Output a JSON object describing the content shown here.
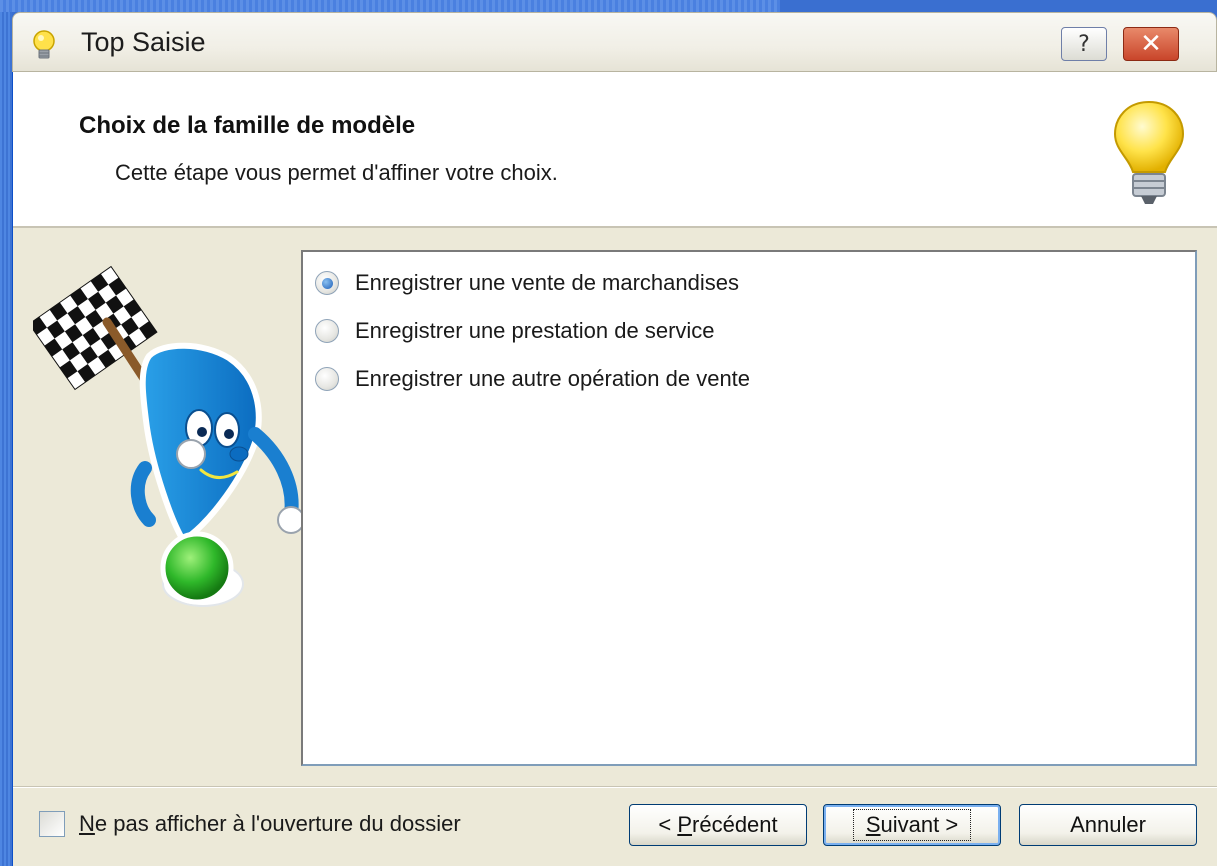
{
  "window": {
    "title": "Top Saisie",
    "help_glyph": "?",
    "close_glyph": "✕",
    "icons": [
      "lightbulb-icon",
      "help-icon",
      "close-icon"
    ]
  },
  "header": {
    "title": "Choix de la famille de modèle",
    "subtitle": "Cette étape vous permet d'affiner votre choix."
  },
  "options": [
    {
      "label": "Enregistrer une vente de marchandises",
      "selected": true
    },
    {
      "label": "Enregistrer une prestation de service",
      "selected": false
    },
    {
      "label": "Enregistrer une autre opération de vente",
      "selected": false
    }
  ],
  "footer": {
    "checkbox_mnemonic": "N",
    "checkbox_rest": "e pas afficher à l'ouverture du dossier",
    "checkbox_checked": false,
    "prev_prefix": "< ",
    "prev_mnemonic": "P",
    "prev_rest": "récédent",
    "next_mnemonic": "S",
    "next_rest": "uivant >",
    "cancel_label": "Annuler"
  },
  "colors": {
    "titlebar_close": "#c9452a",
    "radio_selected": "#1e5fb8",
    "window_frame": "#0a55e0",
    "dialog_bg": "#ece9d8"
  }
}
